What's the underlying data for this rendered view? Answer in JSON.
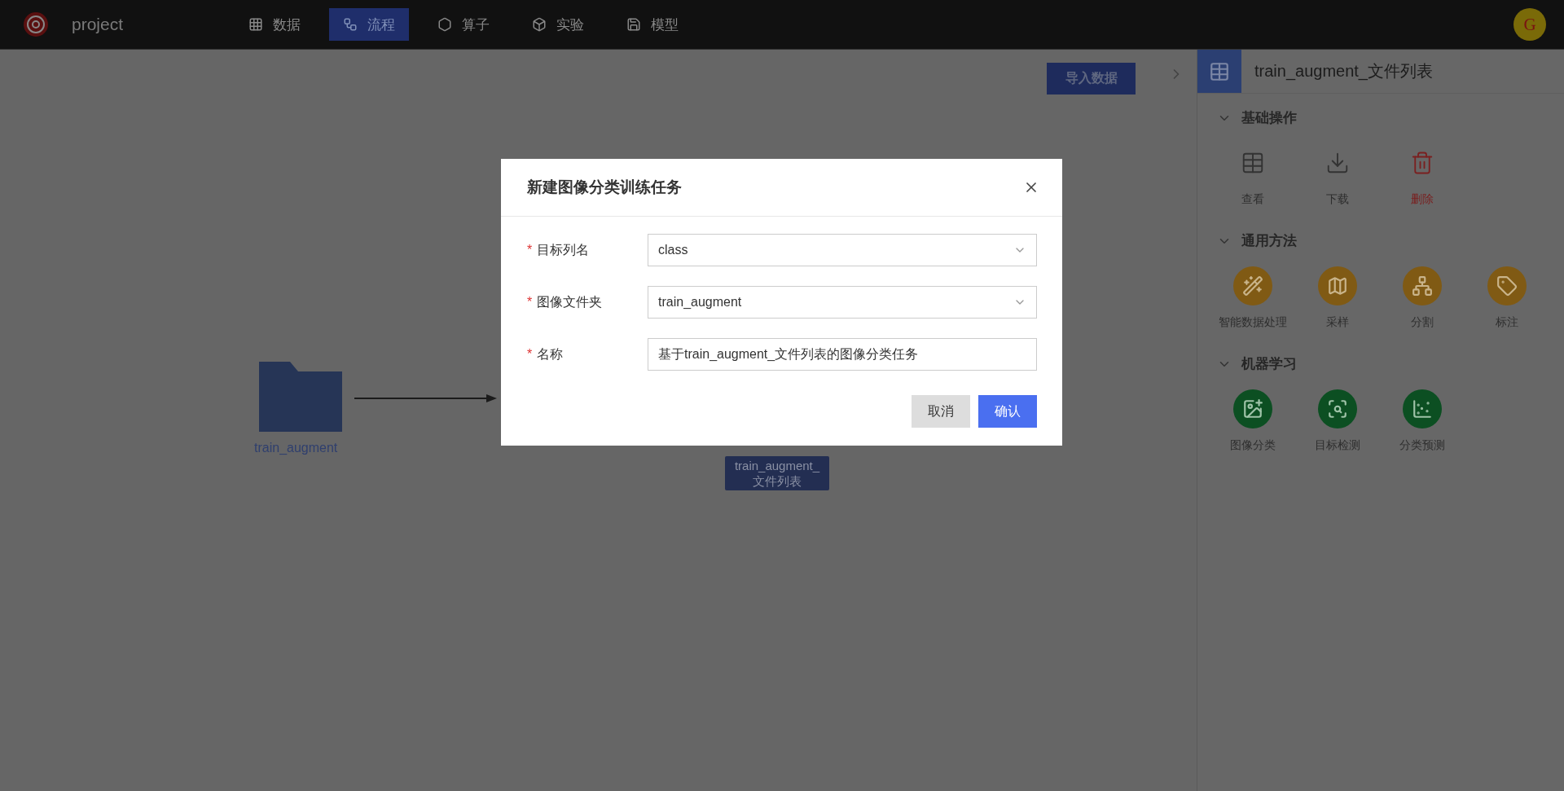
{
  "app": {
    "name": "project",
    "avatar": "G"
  },
  "nav": [
    {
      "label": "数据",
      "selected": false
    },
    {
      "label": "流程",
      "selected": true
    },
    {
      "label": "算子",
      "selected": false
    },
    {
      "label": "实验",
      "selected": false
    },
    {
      "label": "模型",
      "selected": false
    }
  ],
  "canvas": {
    "import_button": "导入数据",
    "nodes": [
      {
        "kind": "folder",
        "label": "train_augment"
      },
      {
        "kind": "table",
        "lines": [
          "train_augment_",
          "文件列表"
        ]
      }
    ]
  },
  "panel": {
    "title": "train_augment_文件列表",
    "sections": [
      {
        "title": "基础操作",
        "kind": "plain",
        "expanded": true,
        "items": [
          {
            "label": "查看",
            "danger": false
          },
          {
            "label": "下载",
            "danger": false
          },
          {
            "label": "删除",
            "danger": true
          }
        ]
      },
      {
        "title": "通用方法",
        "kind": "method",
        "expanded": true,
        "items": [
          {
            "label": "智能数据处理",
            "danger": false
          },
          {
            "label": "采样",
            "danger": false
          },
          {
            "label": "分割",
            "danger": false
          },
          {
            "label": "标注",
            "danger": false
          }
        ]
      },
      {
        "title": "机器学习",
        "kind": "ml",
        "expanded": true,
        "items": [
          {
            "label": "图像分类",
            "danger": false
          },
          {
            "label": "目标检测",
            "danger": false
          },
          {
            "label": "分类预测",
            "danger": false
          }
        ]
      }
    ]
  },
  "dialog": {
    "title": "新建图像分类训练任务",
    "fields": [
      {
        "label": "目标列名",
        "required_mark": "*",
        "kind": "select",
        "value": "class"
      },
      {
        "label": "图像文件夹",
        "required_mark": "*",
        "kind": "select",
        "value": "train_augment"
      },
      {
        "label": "名称",
        "required_mark": "*",
        "kind": "text",
        "value": "基于train_augment_文件列表的图像分类任务"
      }
    ],
    "cancel": "取消",
    "confirm": "确认"
  }
}
